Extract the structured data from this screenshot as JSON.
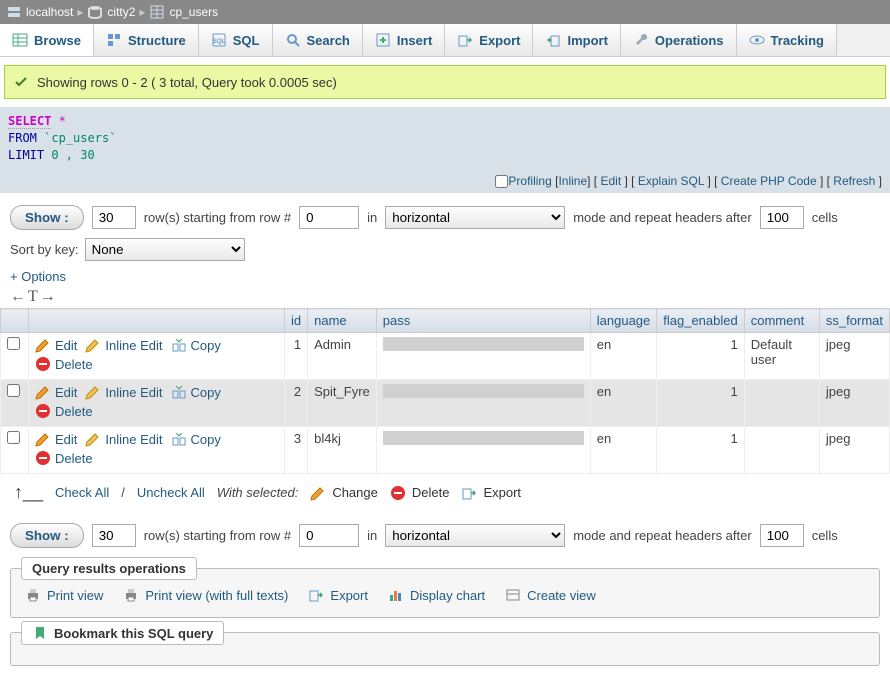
{
  "breadcrumb": {
    "host": "localhost",
    "db": "citty2",
    "table": "cp_users"
  },
  "tabs": {
    "browse": "Browse",
    "structure": "Structure",
    "sql": "SQL",
    "search": "Search",
    "insert": "Insert",
    "export": "Export",
    "import": "Import",
    "operations": "Operations",
    "tracking": "Tracking"
  },
  "success": "Showing rows 0 - 2 ( 3 total, Query took 0.0005 sec)",
  "sql": {
    "select": "SELECT",
    "star": " *",
    "from": "FROM",
    "table": "`cp_users`",
    "limit": "LIMIT",
    "range": "0 , 30"
  },
  "sqllinks": {
    "profiling": "Profiling",
    "inline": "Inline",
    "edit": "Edit",
    "explain": "Explain SQL",
    "php": "Create PHP Code",
    "refresh": "Refresh"
  },
  "show": {
    "btn": "Show :",
    "rows": "30",
    "rows_from": "row(s) starting from row #",
    "start": "0",
    "in": "in",
    "mode": "horizontal",
    "repeat": "mode and repeat headers after",
    "every": "100",
    "cells": "cells"
  },
  "sortby": {
    "label": "Sort by key:",
    "value": "None"
  },
  "options": "+ Options",
  "cols": {
    "id": "id",
    "name": "name",
    "pass": "pass",
    "language": "language",
    "flag_enabled": "flag_enabled",
    "comment": "comment",
    "ss_format": "ss_format"
  },
  "rowactions": {
    "edit": "Edit",
    "inline": "Inline Edit",
    "copy": "Copy",
    "delete": "Delete"
  },
  "rows": [
    {
      "id": "1",
      "name": "Admin",
      "language": "en",
      "flag_enabled": "1",
      "comment": "Default user",
      "ss_format": "jpeg"
    },
    {
      "id": "2",
      "name": "Spit_Fyre",
      "language": "en",
      "flag_enabled": "1",
      "comment": "",
      "ss_format": "jpeg"
    },
    {
      "id": "3",
      "name": "bl4kj",
      "language": "en",
      "flag_enabled": "1",
      "comment": "",
      "ss_format": "jpeg"
    }
  ],
  "bulk": {
    "checkall": "Check All",
    "uncheckall": "Uncheck All",
    "withsel": "With selected:",
    "change": "Change",
    "delete": "Delete",
    "export": "Export"
  },
  "results_ops": {
    "legend": "Query results operations",
    "print": "Print view",
    "printfull": "Print view (with full texts)",
    "export": "Export",
    "chart": "Display chart",
    "createview": "Create view"
  },
  "bookmark": {
    "legend": "Bookmark this SQL query"
  }
}
